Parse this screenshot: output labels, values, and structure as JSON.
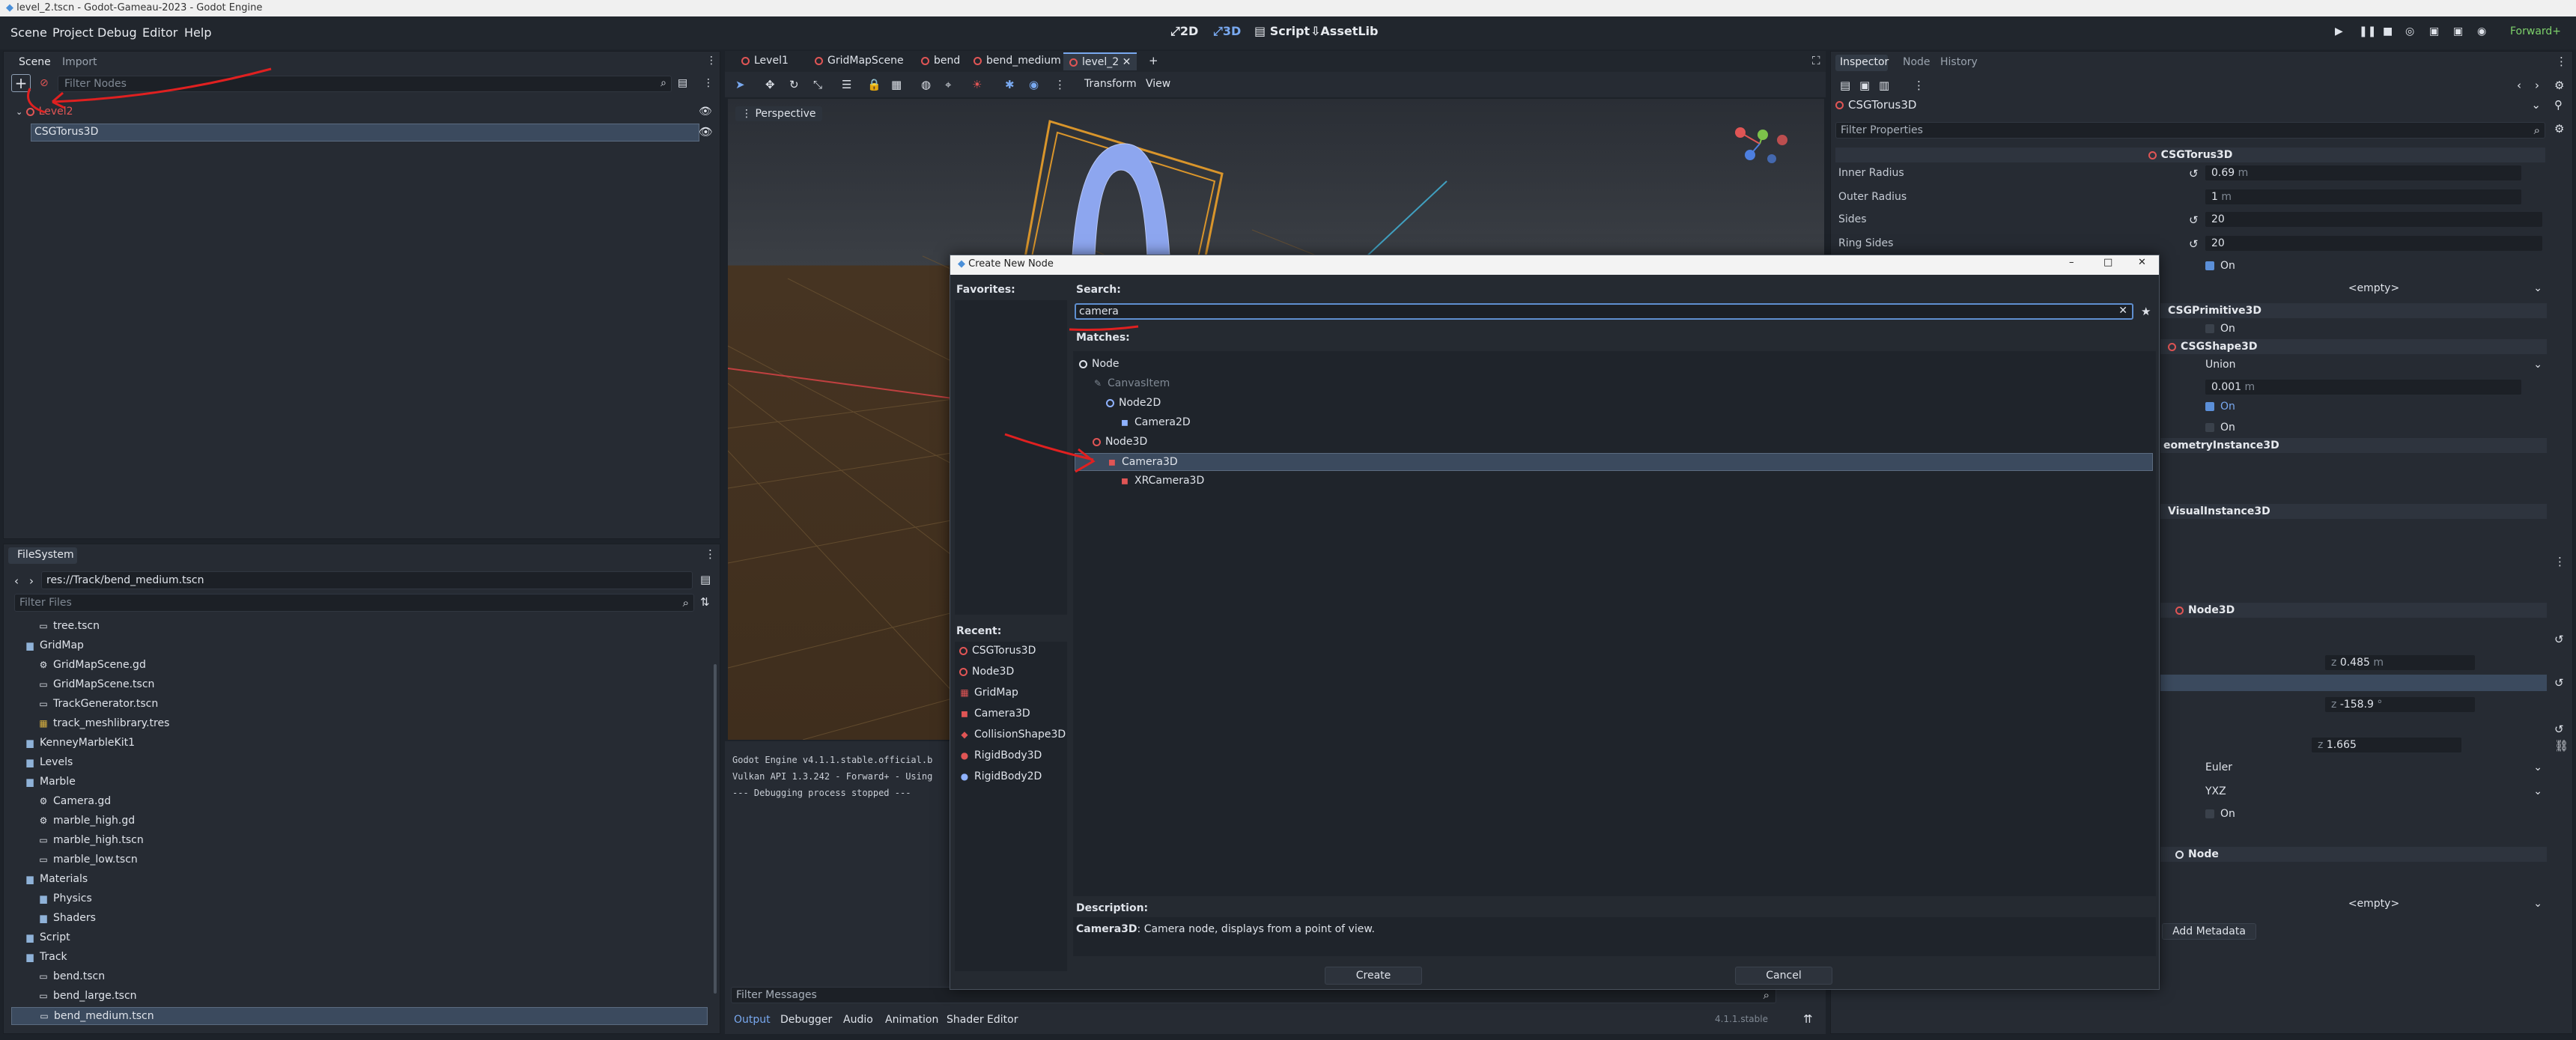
{
  "window": {
    "title": "level_2.tscn - Godot-Gameau-2023 - Godot Engine"
  },
  "menu": [
    "Scene",
    "Project",
    "Debug",
    "Editor",
    "Help"
  ],
  "workspaces": [
    "2D",
    "3D",
    "Script",
    "AssetLib"
  ],
  "renderer": "Forward+",
  "scene_dock": {
    "tabs": [
      "Scene",
      "Import"
    ],
    "filter_placeholder": "Filter Nodes",
    "tree": [
      {
        "label": "Level2"
      },
      {
        "label": "CSGTorus3D"
      }
    ]
  },
  "filesystem": {
    "tab": "FileSystem",
    "path": "res://Track/bend_medium.tscn",
    "filter_placeholder": "Filter Files",
    "items": [
      {
        "label": "tree.tscn",
        "kind": "scene",
        "indent": 2
      },
      {
        "label": "GridMap",
        "kind": "folder",
        "indent": 1
      },
      {
        "label": "GridMapScene.gd",
        "kind": "gear",
        "indent": 2
      },
      {
        "label": "GridMapScene.tscn",
        "kind": "scene",
        "indent": 2
      },
      {
        "label": "TrackGenerator.tscn",
        "kind": "scene",
        "indent": 2
      },
      {
        "label": "track_meshlibrary.tres",
        "kind": "grid",
        "indent": 2
      },
      {
        "label": "KenneyMarbleKit1",
        "kind": "folder",
        "indent": 1
      },
      {
        "label": "Levels",
        "kind": "folder",
        "indent": 1
      },
      {
        "label": "Marble",
        "kind": "folder",
        "indent": 1
      },
      {
        "label": "Camera.gd",
        "kind": "gear",
        "indent": 2
      },
      {
        "label": "marble_high.gd",
        "kind": "gear",
        "indent": 2
      },
      {
        "label": "marble_high.tscn",
        "kind": "scene",
        "indent": 2
      },
      {
        "label": "marble_low.tscn",
        "kind": "scene",
        "indent": 2
      },
      {
        "label": "Materials",
        "kind": "folder",
        "indent": 1
      },
      {
        "label": "Physics",
        "kind": "folder",
        "indent": 2
      },
      {
        "label": "Shaders",
        "kind": "folder",
        "indent": 2
      },
      {
        "label": "Script",
        "kind": "folder",
        "indent": 1
      },
      {
        "label": "Track",
        "kind": "folder",
        "indent": 1
      },
      {
        "label": "bend.tscn",
        "kind": "scene",
        "indent": 2
      },
      {
        "label": "bend_large.tscn",
        "kind": "scene",
        "indent": 2
      },
      {
        "label": "bend_medium.tscn",
        "kind": "scene",
        "indent": 2
      }
    ]
  },
  "editor_tabs": [
    "Level1",
    "GridMapScene",
    "bend",
    "bend_medium",
    "level_2"
  ],
  "viewport": {
    "toolbar_menus": [
      "Transform",
      "View"
    ],
    "perspective_label": "Perspective"
  },
  "output": {
    "lines": [
      "Godot Engine v4.1.1.stable.official.b",
      "Vulkan API 1.3.242 - Forward+ - Using",
      "",
      "--- Debugging process stopped ---"
    ],
    "filter_placeholder": "Filter Messages",
    "tabs": [
      "Output",
      "Debugger",
      "Audio",
      "Animation",
      "Shader Editor"
    ],
    "version": "4.1.1.stable"
  },
  "dialog": {
    "title": "Create New Node",
    "favorites_label": "Favorites:",
    "search_label": "Search:",
    "search_value": "camera",
    "matches_label": "Matches:",
    "tree": [
      {
        "label": "Node",
        "indent": 0,
        "icon": "ringw"
      },
      {
        "label": "CanvasItem",
        "indent": 1,
        "icon": "pencil",
        "dim": true
      },
      {
        "label": "Node2D",
        "indent": 2,
        "icon": "ringb"
      },
      {
        "label": "Camera2D",
        "indent": 3,
        "icon": "cam2d"
      },
      {
        "label": "Node3D",
        "indent": 1,
        "icon": "ring"
      },
      {
        "label": "Camera3D",
        "indent": 2,
        "icon": "cam3d",
        "selected": true
      },
      {
        "label": "XRCamera3D",
        "indent": 3,
        "icon": "cam3d"
      }
    ],
    "recent_label": "Recent:",
    "recent": [
      "CSGTorus3D",
      "Node3D",
      "GridMap",
      "Camera3D",
      "CollisionShape3D",
      "RigidBody3D",
      "RigidBody2D"
    ],
    "description_label": "Description:",
    "description_name": "Camera3D",
    "description_text": ": Camera node, displays from a point of view.",
    "create_label": "Create",
    "cancel_label": "Cancel"
  },
  "inspector": {
    "tabs": [
      "Inspector",
      "Node",
      "History"
    ],
    "object": "CSGTorus3D",
    "filter_placeholder": "Filter Properties",
    "class_header": "CSGTorus3D",
    "props": [
      {
        "label": "Inner Radius",
        "value": "0.69",
        "unit": "m"
      },
      {
        "label": "Outer Radius",
        "value": "1",
        "unit": "m"
      },
      {
        "label": "Sides",
        "value": "20"
      },
      {
        "label": "Ring Sides",
        "value": "20"
      }
    ],
    "smooth_on": "On",
    "material_value": "<empty>",
    "csgprimitive_header": "CSGPrimitive3D",
    "csgprimitive_on": "On",
    "csgshape_header": "CSGShape3D",
    "operation": "Union",
    "snap_value": "0.001",
    "snap_unit": "m",
    "on_a": "On",
    "on_b": "On",
    "geometry_header": "eometryInstance3D",
    "visual_header": "VisualInstance3D",
    "node3d_header": "Node3D",
    "pos_z": "0.485",
    "pos_unit": "m",
    "rot_z": "-158.9",
    "rot_unit": "°",
    "scale_z": "1.665",
    "rotation_edit": "Euler",
    "rotation_order": "YXZ",
    "top_level_on": "On",
    "node_header": "Node",
    "script_value": "<empty>",
    "add_metadata": "Add Metadata"
  }
}
